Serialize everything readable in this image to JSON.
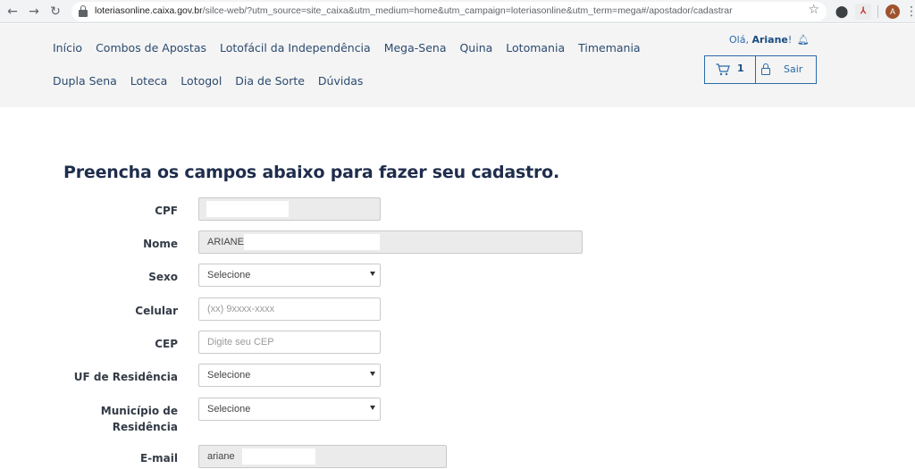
{
  "browser": {
    "url_host": "loteriasonline.caixa.gov.br",
    "url_path": "/silce-web/?utm_source=site_caixa&utm_medium=home&utm_campaign=loteriasonline&utm_term=mega#/apostador/cadastrar",
    "avatar_letter": "A",
    "icons": [
      "back-arrow-icon",
      "forward-arrow-icon",
      "reload-icon",
      "lock-icon",
      "star-icon",
      "extension-icon",
      "pdf-icon",
      "menu-dots-icon"
    ]
  },
  "header": {
    "nav_row1": [
      "Início",
      "Combos de Apostas",
      "Lotofácil da Independência",
      "Mega-Sena",
      "Quina",
      "Lotomania",
      "Timemania"
    ],
    "nav_row2": [
      "Dupla Sena",
      "Loteca",
      "Lotogol",
      "Dia de Sorte",
      "Dúvidas"
    ],
    "greeting_prefix": "Olá, ",
    "user_name": "Ariane",
    "greeting_suffix": "!",
    "cart_count": "1",
    "logout_label": "Sair"
  },
  "form": {
    "title": "Preencha os campos abaixo para fazer seu cadastro.",
    "cpf": {
      "label": "CPF",
      "value": ""
    },
    "nome": {
      "label": "Nome",
      "value": "ARIANE"
    },
    "sexo": {
      "label": "Sexo",
      "value": "Selecione"
    },
    "celular": {
      "label": "Celular",
      "placeholder": "(xx) 9xxxx-xxxx"
    },
    "cep": {
      "label": "CEP",
      "placeholder": "Digite seu CEP"
    },
    "uf": {
      "label": "UF de Residência",
      "value": "Selecione"
    },
    "municipio": {
      "label_line1": "Município de",
      "label_line2": "Residência",
      "value": "Selecione"
    },
    "email": {
      "label": "E-mail",
      "value": "ariane"
    }
  },
  "colors": {
    "nav_text": "#2b4a6f",
    "accent": "#2b6aa8",
    "title": "#1f2d4d",
    "header_bg": "#f4f4f4"
  }
}
